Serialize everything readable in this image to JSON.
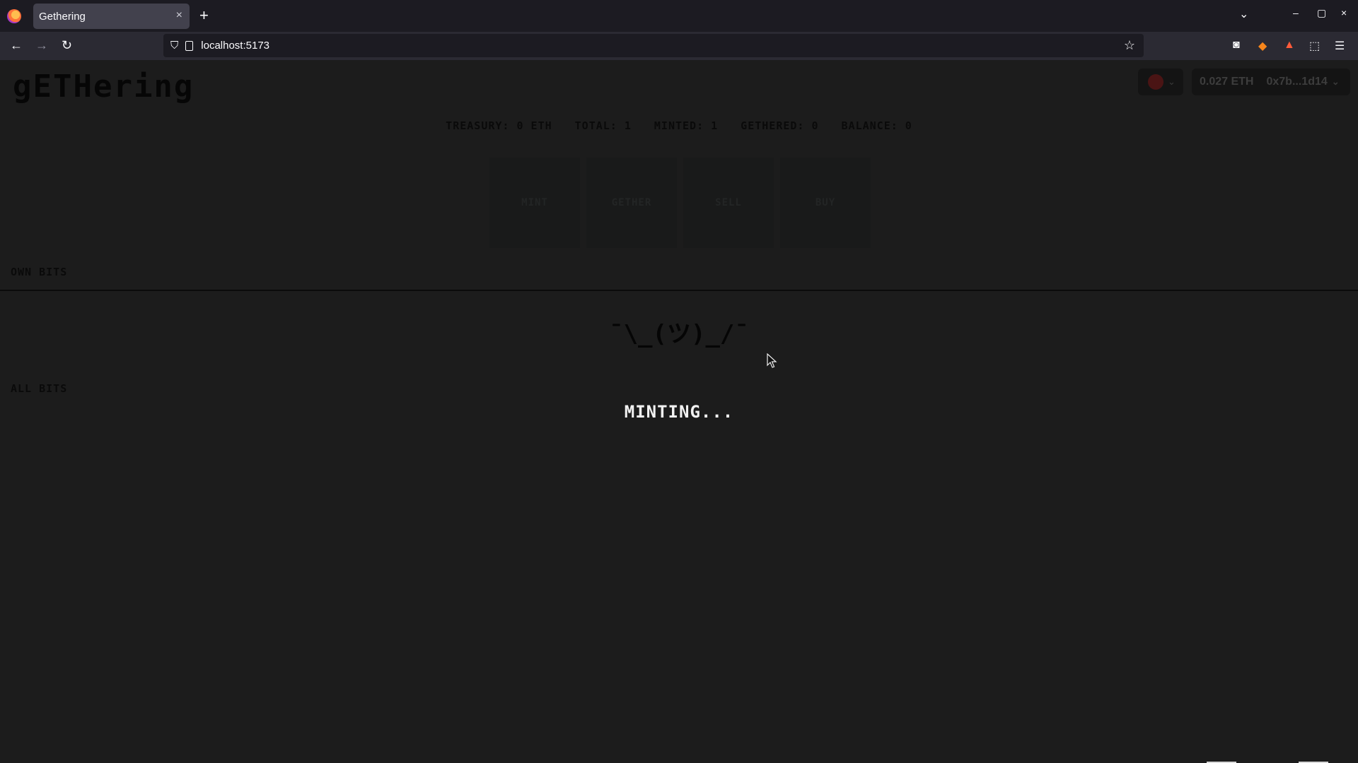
{
  "browser": {
    "tab_title": "Gethering",
    "tab_close": "×",
    "new_tab": "+",
    "tab_list": "⌄",
    "url": "localhost:5173",
    "window": {
      "minimize": "–",
      "maximize": "▢",
      "close": "×"
    }
  },
  "nav": {
    "back": "←",
    "forward": "→",
    "reload": "↻",
    "bookmark": "☆"
  },
  "header": {
    "logo": "gETHering",
    "network_chevron": "⌄",
    "balance": "0.027 ETH",
    "address": "0x7b...1d14",
    "account_chevron": "⌄"
  },
  "stats": [
    {
      "label": "Treasury: 0 ETH"
    },
    {
      "label": "Total: 1"
    },
    {
      "label": "Minted: 1"
    },
    {
      "label": "Gethered: 0"
    },
    {
      "label": "Balance: 0"
    }
  ],
  "actions": [
    {
      "label": "Mint"
    },
    {
      "label": "Gether"
    },
    {
      "label": "Sell"
    },
    {
      "label": "Buy"
    }
  ],
  "sections": {
    "own": "Own Bits",
    "all": "All Bits"
  },
  "empty_state": "¯\\_(ツ)_/¯",
  "status": "MINTING...",
  "colors": {
    "background": "#1c1c1c",
    "status_text": "#f2f2f2",
    "browser_chrome": "#2b2a33"
  }
}
